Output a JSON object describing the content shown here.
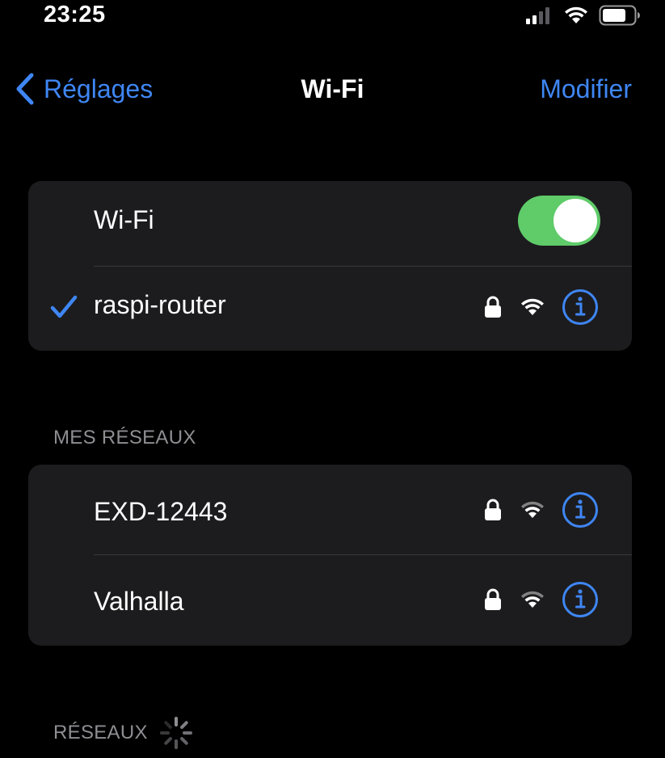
{
  "status_bar": {
    "time": "23:25",
    "icons": [
      "cellular-signal-icon",
      "wifi-icon",
      "battery-icon"
    ]
  },
  "nav": {
    "back_label": "Réglages",
    "title": "Wi-Fi",
    "action_label": "Modifier"
  },
  "wifi_group": {
    "toggle_label": "Wi-Fi",
    "toggle_on": true,
    "connected_network": {
      "name": "raspi-router",
      "secured": true
    }
  },
  "my_networks": {
    "header": "MES RÉSEAUX",
    "items": [
      {
        "name": "EXD-12443",
        "secured": true
      },
      {
        "name": "Valhalla",
        "secured": true
      }
    ]
  },
  "networks": {
    "header": "RÉSEAUX",
    "loading_icon": "spinner-icon"
  },
  "colors": {
    "accent": "#3f86f4",
    "toggle_on": "#5fcb69",
    "group_bg": "#1c1c1e",
    "separator": "#38383a",
    "secondary_text": "#8e8e93",
    "background": "#000000"
  }
}
